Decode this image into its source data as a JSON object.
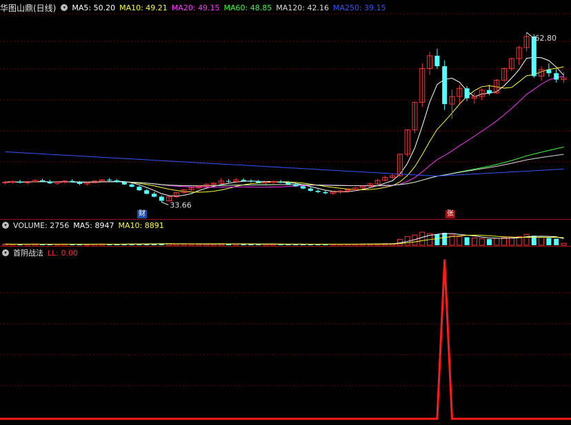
{
  "header": {
    "stock_name": "华图山鼎(日线)",
    "ma": [
      {
        "label": "MA5: 50.20",
        "color": "#ffffff"
      },
      {
        "label": "MA10: 49.21",
        "color": "#ffff33"
      },
      {
        "label": "MA20: 49.15",
        "color": "#ff33ff"
      },
      {
        "label": "MA60: 48.85",
        "color": "#33ff33"
      },
      {
        "label": "MA120: 42.16",
        "color": "#dddddd"
      },
      {
        "label": "MA250: 39.15",
        "color": "#3355ff"
      }
    ]
  },
  "volume_header": {
    "volume": "VOLUME: 2756",
    "ma5": "MA5: 8947",
    "ma10": "MA10: 8891"
  },
  "indicator_header": {
    "name": "首阴战法",
    "value": "LL: 0.00"
  },
  "annotations": {
    "high_label": "62.80",
    "low_label": "33.66",
    "badge_cai": "财",
    "badge_zhang": "张"
  },
  "colors": {
    "up": "#ff3232",
    "down": "#54ffff",
    "grid": "#7a0000",
    "indicator": "#ff1a1a"
  },
  "chart_data": [
    {
      "type": "candlestick",
      "title": "华图山鼎(日线)",
      "ylim": [
        31,
        66
      ],
      "annotations": [
        {
          "label": "62.80",
          "kind": "high"
        },
        {
          "label": "33.66",
          "kind": "low"
        }
      ],
      "candles_ohlc": [
        [
          37.0,
          37.3,
          36.7,
          37.1
        ],
        [
          37.1,
          37.4,
          36.8,
          37.2
        ],
        [
          37.2,
          37.5,
          36.9,
          37.0
        ],
        [
          37.0,
          37.3,
          36.7,
          37.2
        ],
        [
          37.2,
          37.6,
          37.0,
          37.4
        ],
        [
          37.4,
          37.7,
          37.1,
          37.2
        ],
        [
          37.2,
          37.5,
          36.8,
          36.9
        ],
        [
          36.9,
          37.2,
          36.6,
          37.1
        ],
        [
          37.1,
          37.4,
          36.8,
          37.3
        ],
        [
          37.3,
          37.6,
          37.0,
          37.1
        ],
        [
          37.1,
          37.3,
          36.6,
          36.8
        ],
        [
          36.8,
          37.1,
          36.5,
          37.0
        ],
        [
          37.0,
          37.4,
          36.9,
          37.3
        ],
        [
          37.3,
          37.6,
          37.0,
          37.5
        ],
        [
          37.5,
          37.8,
          37.2,
          37.4
        ],
        [
          37.4,
          37.6,
          37.0,
          37.1
        ],
        [
          37.1,
          37.3,
          36.6,
          36.7
        ],
        [
          36.7,
          37.0,
          36.2,
          36.3
        ],
        [
          36.3,
          36.5,
          35.6,
          35.7
        ],
        [
          35.7,
          35.9,
          35.0,
          35.1
        ],
        [
          35.1,
          35.4,
          34.5,
          34.6
        ],
        [
          34.6,
          34.8,
          33.66,
          33.9
        ],
        [
          33.9,
          34.7,
          33.8,
          34.6
        ],
        [
          34.6,
          35.4,
          34.4,
          35.3
        ],
        [
          35.3,
          35.9,
          35.1,
          35.8
        ],
        [
          35.8,
          36.3,
          35.6,
          36.1
        ],
        [
          36.1,
          36.6,
          35.9,
          36.4
        ],
        [
          36.4,
          36.9,
          36.2,
          36.7
        ],
        [
          36.7,
          37.1,
          36.5,
          36.9
        ],
        [
          36.9,
          37.8,
          36.8,
          37.3
        ],
        [
          37.3,
          37.6,
          37.0,
          37.2
        ],
        [
          37.2,
          37.8,
          37.0,
          37.5
        ],
        [
          37.5,
          37.8,
          37.2,
          37.3
        ],
        [
          37.3,
          37.6,
          37.0,
          37.2
        ],
        [
          37.2,
          37.5,
          36.9,
          37.0
        ],
        [
          37.0,
          37.3,
          36.7,
          37.1
        ],
        [
          37.1,
          37.4,
          36.8,
          37.2
        ],
        [
          37.2,
          37.5,
          36.9,
          37.0
        ],
        [
          37.0,
          37.3,
          36.6,
          36.7
        ],
        [
          36.7,
          37.0,
          36.3,
          36.4
        ],
        [
          36.4,
          36.7,
          35.9,
          36.0
        ],
        [
          36.0,
          36.3,
          35.5,
          35.6
        ],
        [
          35.6,
          35.9,
          35.2,
          35.4
        ],
        [
          35.4,
          35.7,
          35.0,
          35.2
        ],
        [
          35.2,
          35.6,
          34.9,
          35.4
        ],
        [
          35.4,
          35.8,
          35.1,
          35.6
        ],
        [
          35.6,
          36.0,
          35.3,
          35.8
        ],
        [
          35.8,
          36.3,
          35.6,
          36.1
        ],
        [
          36.1,
          36.6,
          35.9,
          36.4
        ],
        [
          36.4,
          37.0,
          36.2,
          36.8
        ],
        [
          36.8,
          37.6,
          36.6,
          37.4
        ],
        [
          37.4,
          38.2,
          37.2,
          37.9
        ],
        [
          37.9,
          38.6,
          37.6,
          38.2
        ],
        [
          38.2,
          41.9,
          38.0,
          41.9
        ],
        [
          41.9,
          46.1,
          41.5,
          46.1
        ],
        [
          46.1,
          50.8,
          45.5,
          50.8
        ],
        [
          50.8,
          57.5,
          50.0,
          56.6
        ],
        [
          56.6,
          59.5,
          55.5,
          58.8
        ],
        [
          58.8,
          60.0,
          56.5,
          57.0
        ],
        [
          57.0,
          58.0,
          49.5,
          50.5
        ],
        [
          50.5,
          53.0,
          48.0,
          51.8
        ],
        [
          51.8,
          53.8,
          50.5,
          53.2
        ],
        [
          53.2,
          53.6,
          51.0,
          51.5
        ],
        [
          51.5,
          52.5,
          50.5,
          51.8
        ],
        [
          51.8,
          53.2,
          51.2,
          52.9
        ],
        [
          52.9,
          53.8,
          52.0,
          52.4
        ],
        [
          52.4,
          54.8,
          52.2,
          54.6
        ],
        [
          54.6,
          56.8,
          54.3,
          56.6
        ],
        [
          56.6,
          58.5,
          56.2,
          58.3
        ],
        [
          58.3,
          60.5,
          57.2,
          60.2
        ],
        [
          60.2,
          62.8,
          59.5,
          62.1
        ],
        [
          62.1,
          62.5,
          55.0,
          55.3
        ],
        [
          55.3,
          57.0,
          54.5,
          56.4
        ],
        [
          56.4,
          57.5,
          55.2,
          55.8
        ],
        [
          55.8,
          56.5,
          54.2,
          54.7
        ],
        [
          54.7,
          56.0,
          54.1,
          55.0
        ]
      ],
      "ma_series": [
        {
          "name": "MA5",
          "value": 50.2
        },
        {
          "name": "MA10",
          "value": 49.21
        },
        {
          "name": "MA20",
          "value": 49.15
        },
        {
          "name": "MA60",
          "value": 48.85
        },
        {
          "name": "MA120",
          "value": 42.16
        },
        {
          "name": "MA250",
          "value": 39.15
        }
      ]
    },
    {
      "type": "bar",
      "title": "VOLUME",
      "series": [
        {
          "name": "VOLUME",
          "last": 2756
        },
        {
          "name": "MA5",
          "last": 8947
        },
        {
          "name": "MA10",
          "last": 8891
        }
      ],
      "values": [
        1500,
        1400,
        1300,
        1450,
        1600,
        1500,
        1350,
        1250,
        1400,
        1500,
        1300,
        1200,
        1450,
        1600,
        1500,
        1400,
        1700,
        1800,
        1900,
        2000,
        2100,
        2400,
        2000,
        1800,
        1700,
        1600,
        1500,
        1700,
        1600,
        2100,
        1700,
        1900,
        1600,
        1500,
        1400,
        1450,
        1500,
        1400,
        1350,
        1300,
        1450,
        1500,
        1400,
        1350,
        1400,
        1450,
        1500,
        1550,
        1600,
        1700,
        1900,
        2100,
        2300,
        8000,
        12000,
        14000,
        18000,
        16000,
        15000,
        17000,
        14000,
        12000,
        11000,
        10000,
        9000,
        8500,
        9500,
        10500,
        11000,
        12000,
        15000,
        13000,
        11000,
        10000,
        9000,
        2756
      ]
    },
    {
      "type": "line",
      "title": "首阴战法",
      "series": [
        {
          "name": "LL",
          "last": 0.0
        }
      ],
      "ylim": [
        0,
        1
      ],
      "values": [
        0,
        0,
        0,
        0,
        0,
        0,
        0,
        0,
        0,
        0,
        0,
        0,
        0,
        0,
        0,
        0,
        0,
        0,
        0,
        0,
        0,
        0,
        0,
        0,
        0,
        0,
        0,
        0,
        0,
        0,
        0,
        0,
        0,
        0,
        0,
        0,
        0,
        0,
        0,
        0,
        0,
        0,
        0,
        0,
        0,
        0,
        0,
        0,
        0,
        0,
        0,
        0,
        0,
        0,
        0,
        0,
        0,
        0,
        0,
        1,
        0,
        0,
        0,
        0,
        0,
        0,
        0,
        0,
        0,
        0,
        0,
        0,
        0,
        0,
        0,
        0
      ]
    }
  ]
}
